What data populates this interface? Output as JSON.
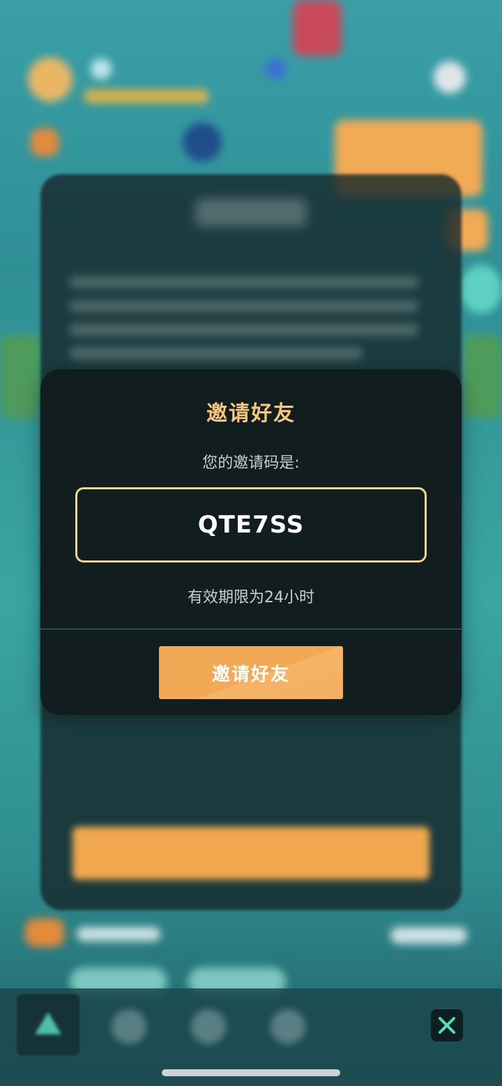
{
  "modal": {
    "title": "邀请好友",
    "subtitle": "您的邀请码是:",
    "invite_code": "QTE7SS",
    "validity": "有效期限为24小时",
    "invite_button_label": "邀请好友"
  },
  "colors": {
    "accent_orange": "#f2a955",
    "title_gold": "#f5c97a",
    "code_border": "#f2d58e",
    "close_icon": "#4fe0b8"
  },
  "icons": {
    "close": "close-icon",
    "home_tab": "home-tab-icon"
  }
}
